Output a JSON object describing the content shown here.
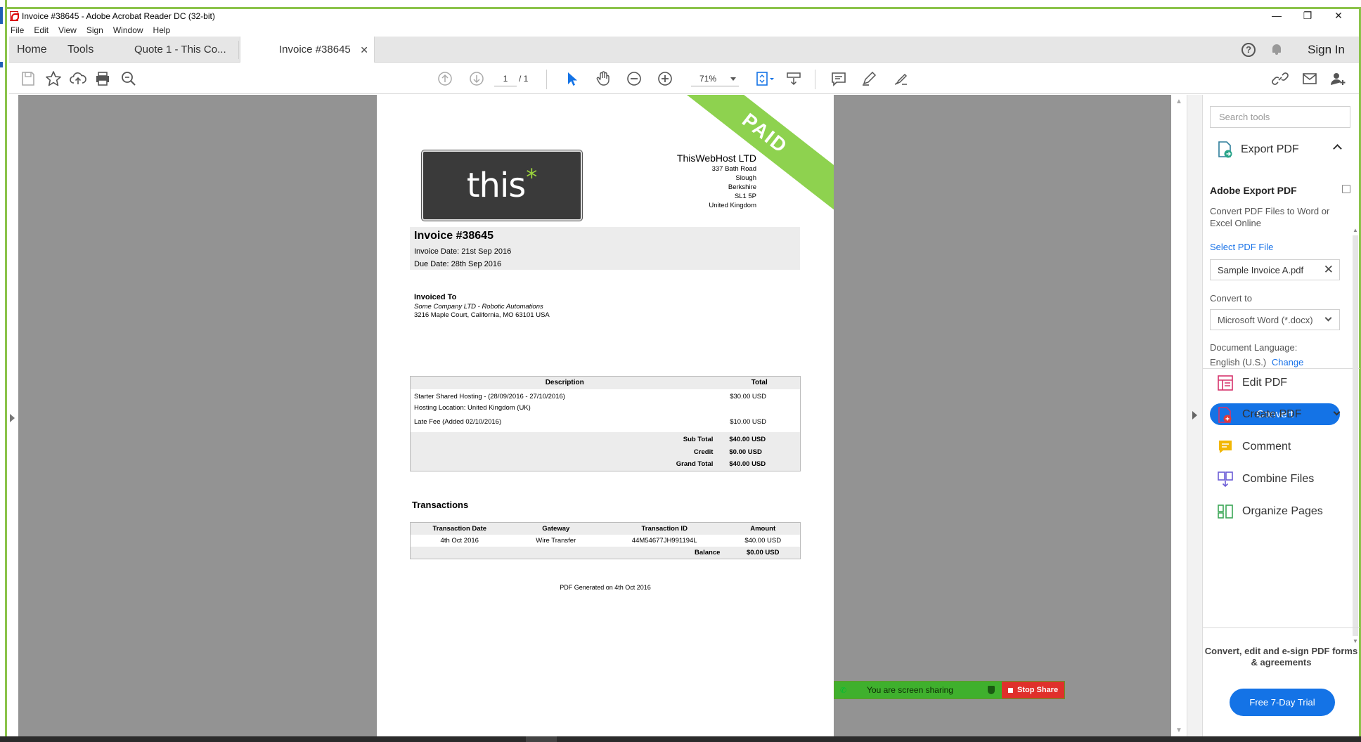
{
  "window": {
    "title": "Invoice #38645 - Adobe Acrobat Reader DC (32-bit)",
    "controls": [
      "minimize",
      "restore",
      "close"
    ]
  },
  "menu": [
    "File",
    "Edit",
    "View",
    "Sign",
    "Window",
    "Help"
  ],
  "tabs": {
    "home": "Home",
    "tools": "Tools",
    "quote": "Quote 1 - This Co...",
    "active": "Invoice #38645",
    "sign_in": "Sign In"
  },
  "toolbar": {
    "page_current": "1",
    "page_total": "/ 1",
    "zoom": "71%",
    "icons": [
      "save-icon",
      "bookmark-star-icon",
      "upload-cloud-icon",
      "print-icon",
      "search-zoom-icon",
      "page-up-icon",
      "page-down-icon",
      "select-arrow-icon",
      "hand-icon",
      "zoom-out-icon",
      "zoom-in-icon",
      "fit-page-icon",
      "scroll-mode-icon",
      "comment-icon",
      "highlight-pen-icon",
      "sign-icon",
      "link-icon",
      "email-icon",
      "add-user-icon"
    ]
  },
  "invoice": {
    "ribbon": "PAID",
    "logo_text": "this",
    "logo_star": "*",
    "company_name": "ThisWebHost LTD",
    "company_lines": [
      "337 Bath Road",
      "Slough",
      "Berkshire",
      "SL1 5P",
      "United Kingdom"
    ],
    "title": "Invoice #38645",
    "invoice_date": "Invoice Date: 21st Sep 2016",
    "due_date": "Due Date: 28th Sep 2016",
    "invoiced_to_label": "Invoiced To",
    "invoiced_to_company": "Some Company LTD - Robotic Automations",
    "invoiced_to_address": "3216 Maple Court,   California, MO 63101 USA",
    "items_header": {
      "description": "Description",
      "total": "Total"
    },
    "items": [
      {
        "description": "Starter Shared Hosting - (28/09/2016 - 27/10/2016)",
        "total": "$30.00 USD"
      },
      {
        "description": "Hosting Location: United Kingdom (UK)",
        "total": ""
      },
      {
        "description": "Late Fee (Added 02/10/2016)",
        "total": "$10.00 USD"
      }
    ],
    "totals": [
      {
        "label": "Sub Total",
        "value": "$40.00 USD"
      },
      {
        "label": "Credit",
        "value": "$0.00 USD"
      },
      {
        "label": "Grand Total",
        "value": "$40.00 USD"
      }
    ],
    "transactions_title": "Transactions",
    "transactions_header": [
      "Transaction Date",
      "Gateway",
      "Transaction ID",
      "Amount"
    ],
    "transactions": [
      {
        "date": "4th Oct 2016",
        "gateway": "Wire Transfer",
        "id": "44M54677JH991194L",
        "amount": "$40.00 USD"
      }
    ],
    "balance_label": "Balance",
    "balance_value": "$0.00 USD",
    "generated": "PDF Generated on 4th Oct 2016"
  },
  "screen_share": {
    "text": "You are screen sharing",
    "stop": "Stop Share"
  },
  "right_panel": {
    "search_placeholder": "Search tools",
    "export_pdf": "Export PDF",
    "adobe_export_title": "Adobe Export PDF",
    "adobe_export_desc": "Convert PDF Files to Word or Excel Online",
    "select_file": "Select PDF File",
    "file_name": "Sample Invoice A.pdf",
    "convert_to_label": "Convert to",
    "convert_to_value": "Microsoft Word (*.docx)",
    "doc_language_label": "Document Language:",
    "doc_language_value": "English (U.S.)",
    "change": "Change",
    "convert_button": "Convert",
    "tools": [
      "Edit PDF",
      "Create PDF",
      "Comment",
      "Combine Files",
      "Organize Pages"
    ],
    "promo": "Convert, edit and e-sign PDF forms & agreements",
    "trial_button": "Free 7-Day Trial"
  },
  "colors": {
    "accent_green": "#8ed24f",
    "acrobat_blue": "#1473e6",
    "share_green": "#3fb02d",
    "share_red": "#e0302b"
  }
}
